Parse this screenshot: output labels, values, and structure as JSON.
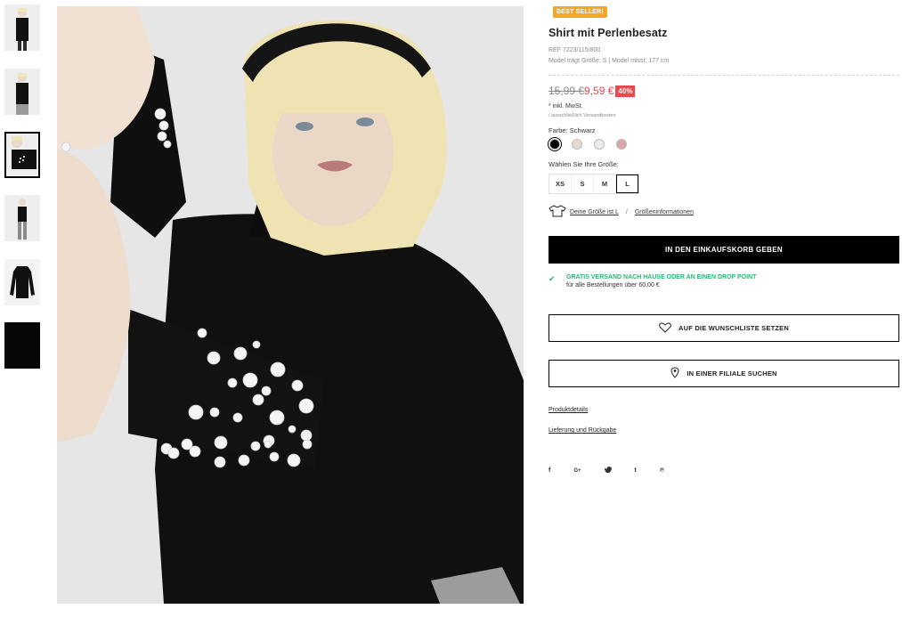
{
  "gallery": {
    "thumbnail_count": 6,
    "active_thumbnail": 3
  },
  "product": {
    "badge": "BEST SELLER!",
    "title": "Shirt mit Perlenbesatz",
    "ref": "REF 7223/115/800",
    "model_info": "Model trägt Größe: S | Model misst: 177 cm",
    "old_price": "15,99 €",
    "new_price": "9,59 €",
    "discount": "40%",
    "tax_note": "* inkl. MwSt.",
    "shipping_note": "/ ausschließlich Versandkosten",
    "color_label": "Farbe:",
    "color_value": "Schwarz",
    "colors": [
      "#000000",
      "#e6dbd3",
      "#ececec",
      "#d8a6a6"
    ],
    "size_label": "Wählen Sie Ihre Größe:",
    "sizes": [
      "XS",
      "S",
      "M",
      "L"
    ],
    "selected_size": "L",
    "your_size": "Deine Größe ist L",
    "size_info": "Größeninformationen",
    "separator": "/",
    "add_to_cart": "IN DEN EINKAUFSKORB GEBEN",
    "free_shipping_title": "GRATIS VERSAND NACH HAUSE ODER AN EINEN DROP POINT",
    "free_shipping_sub": "für alle Bestellungen über 60,00 €",
    "wishlist": "AUF DIE WUNSCHLISTE SETZEN",
    "find_in_store": "IN EINER FILIALE SUCHEN",
    "product_details": "Produktdetails",
    "delivery_returns": "Lieferung und Rückgabe",
    "social": [
      "f",
      "G+",
      "t-bird",
      "t",
      "p"
    ]
  },
  "colors": {
    "accent_badge": "#f5a623",
    "sale_red": "#e8494f",
    "success_green": "#2bb673"
  }
}
